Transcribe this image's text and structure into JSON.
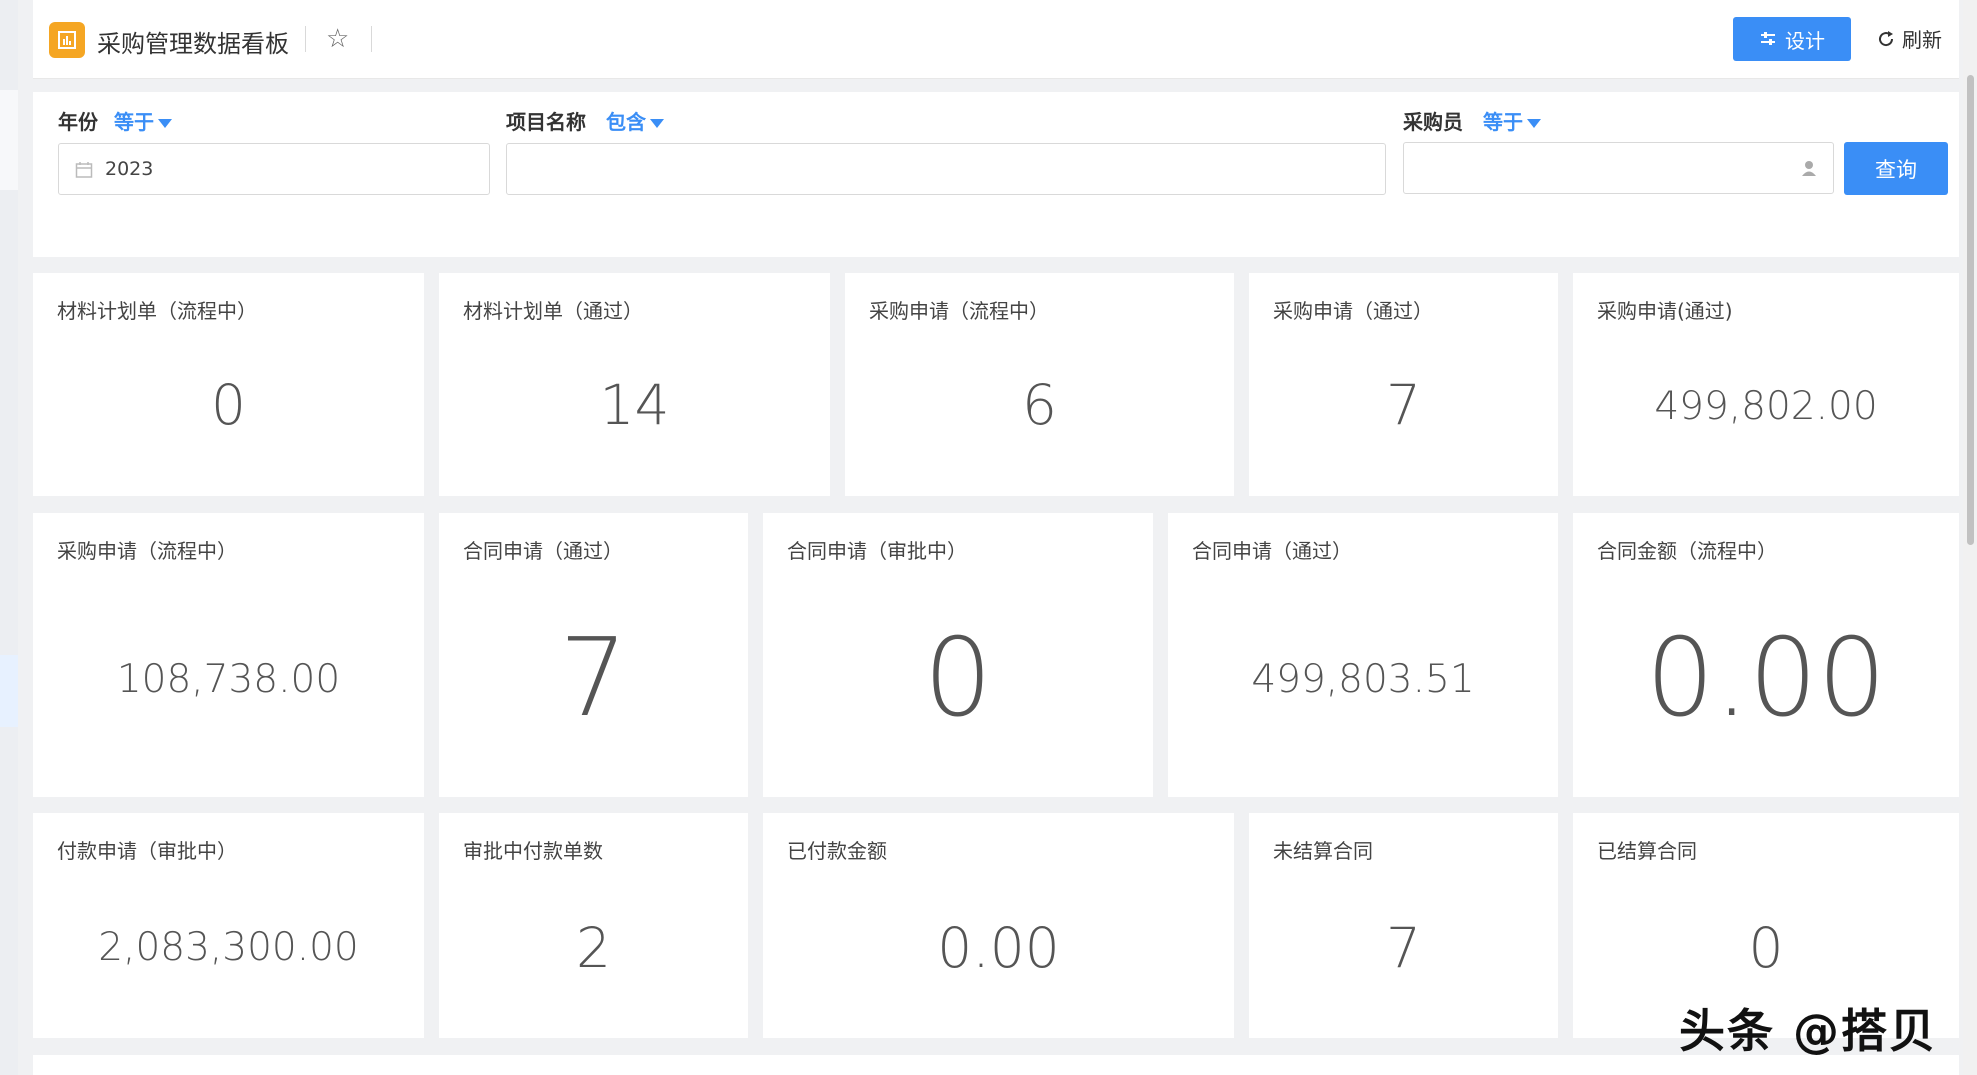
{
  "header": {
    "title": "采购管理数据看板",
    "design_label": "设计",
    "refresh_label": "刷新"
  },
  "filters": {
    "year": {
      "label": "年份",
      "operator": "等于",
      "value": "2023"
    },
    "project": {
      "label": "项目名称",
      "operator": "包含",
      "value": ""
    },
    "buyer": {
      "label": "采购员",
      "operator": "等于",
      "value": ""
    },
    "query_label": "查询"
  },
  "cards": [
    {
      "label": "材料计划单（流程中）",
      "value": "0"
    },
    {
      "label": "材料计划单（通过）",
      "value": "14"
    },
    {
      "label": "采购申请（流程中）",
      "value": "6"
    },
    {
      "label": "采购申请（通过）",
      "value": "7"
    },
    {
      "label": "采购申请(通过)",
      "value": "499,802.00"
    },
    {
      "label": "采购申请（流程中）",
      "value": "108,738.00"
    },
    {
      "label": "合同申请（通过）",
      "value": "7"
    },
    {
      "label": "合同申请（审批中）",
      "value": "0"
    },
    {
      "label": "合同申请（通过）",
      "value": "499,803.51"
    },
    {
      "label": "合同金额（流程中）",
      "value": "0.00"
    },
    {
      "label": "付款申请（审批中）",
      "value": "2,083,300.00"
    },
    {
      "label": "审批中付款单数",
      "value": "2"
    },
    {
      "label": "已付款金额",
      "value": "0.00"
    },
    {
      "label": "未结算合同",
      "value": "7"
    },
    {
      "label": "已结算合同",
      "value": "0"
    }
  ],
  "watermark": "头条 @搭贝",
  "colors": {
    "primary": "#3a8ef6",
    "logo": "#f5a623"
  }
}
